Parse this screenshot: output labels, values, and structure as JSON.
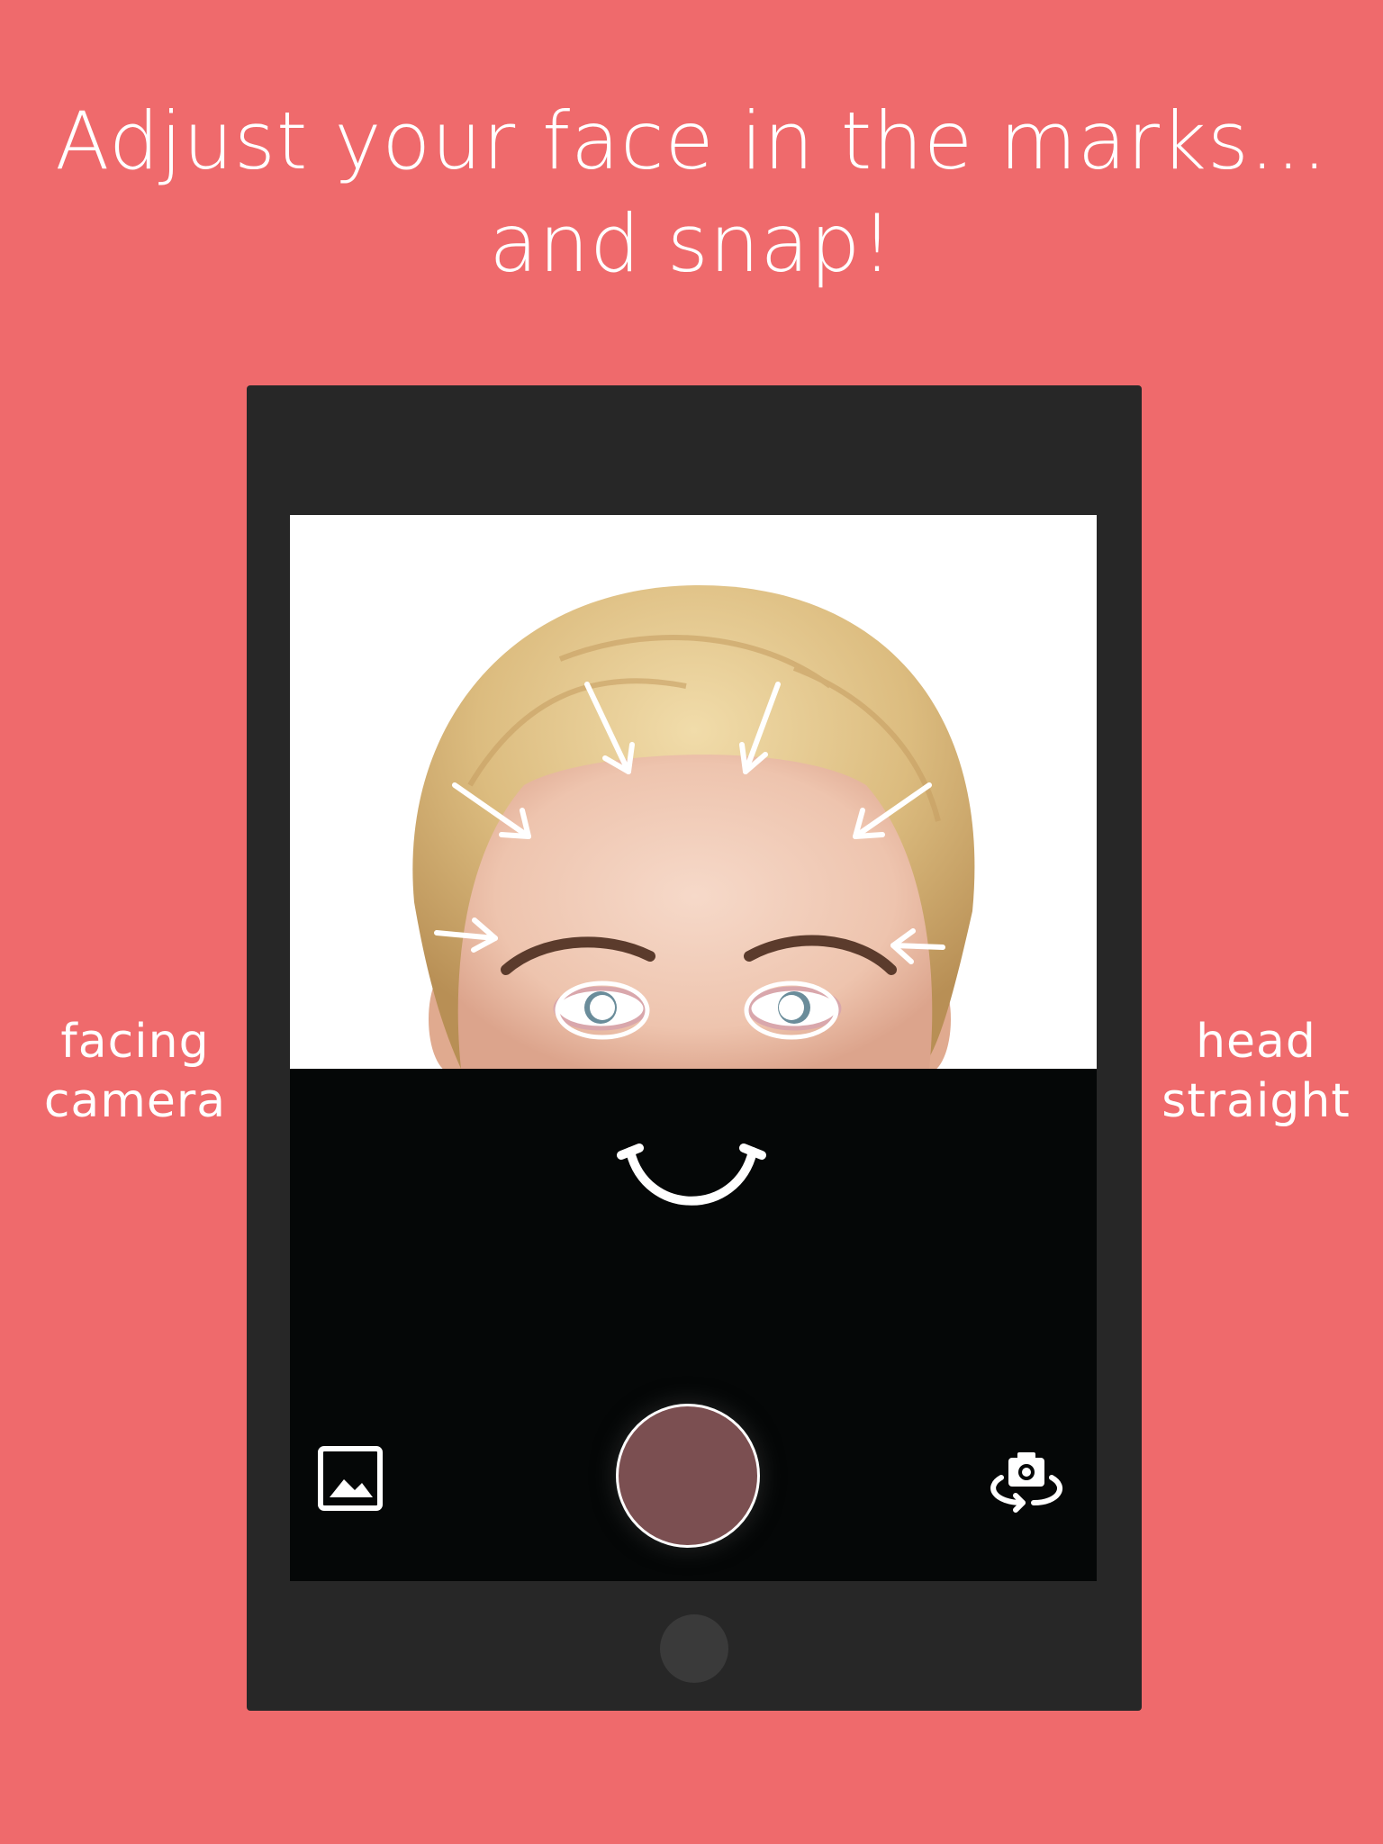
{
  "headline": {
    "line1": "Adjust your face in the marks...",
    "line2": "and snap!"
  },
  "labels": {
    "left": {
      "line1": "facing",
      "line2": "camera"
    },
    "right": {
      "line1": "head",
      "line2": "straight"
    }
  },
  "colors": {
    "background": "#ef6a6c",
    "device_frame": "#272727",
    "screen_black": "#050707",
    "shutter_fill": "#7b4f51",
    "overlay_marks": "#ffffff"
  },
  "icons": {
    "gallery": "gallery-icon",
    "shutter": "shutter-button",
    "flip_camera": "flip-camera-icon",
    "smile": "smile-guide-icon",
    "home": "home-button"
  }
}
